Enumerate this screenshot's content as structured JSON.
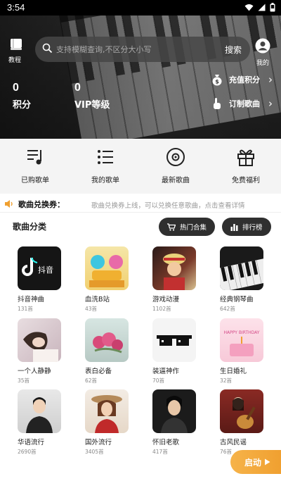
{
  "status_bar": {
    "time": "3:54"
  },
  "header": {
    "tutorial_label": "教程",
    "search_placeholder": "支持模糊查询,不区分大小写",
    "search_button": "搜索",
    "me_label": "我的"
  },
  "stats": [
    {
      "value": "0",
      "label": "积分"
    },
    {
      "value": "0",
      "label": "VIP等级"
    }
  ],
  "hero_links": {
    "recharge": "充值积分",
    "custom_song": "订制歌曲"
  },
  "quick_actions": [
    {
      "label": "已购歌单",
      "icon": "purchased-list-icon"
    },
    {
      "label": "我的歌单",
      "icon": "list-icon"
    },
    {
      "label": "最新歌曲",
      "icon": "disc-icon"
    },
    {
      "label": "免费福利",
      "icon": "gift-icon"
    }
  ],
  "notice": {
    "title": "歌曲兑换券：",
    "text": "歌曲兑换券上线，可以兑换任意歌曲，点击查看详情"
  },
  "category": {
    "title": "歌曲分类",
    "hot_button": "热门合集",
    "rank_button": "排行榜"
  },
  "categories": [
    {
      "name": "抖音神曲",
      "count": "131首"
    },
    {
      "name": "血洗B站",
      "count": "43首"
    },
    {
      "name": "游戏动漫",
      "count": "1102首"
    },
    {
      "name": "经典钢琴曲",
      "count": "642首"
    },
    {
      "name": "一个人静静",
      "count": "35首"
    },
    {
      "name": "表白必备",
      "count": "62首"
    },
    {
      "name": "装逼神作",
      "count": "70首"
    },
    {
      "name": "生日婚礼",
      "count": "32首"
    },
    {
      "name": "华语流行",
      "count": "2690首"
    },
    {
      "name": "国外流行",
      "count": "3405首"
    },
    {
      "name": "怀旧老歌",
      "count": "417首"
    },
    {
      "name": "古风民谣",
      "count": "76首"
    }
  ],
  "tile_art": {
    "douyin_logo_text": "抖音",
    "birthday_text": "HAPPY BIRTHDAY"
  },
  "start_button": "启动",
  "colors": {
    "accent": "#f0a030",
    "dark_pill": "#2f2f2f"
  }
}
